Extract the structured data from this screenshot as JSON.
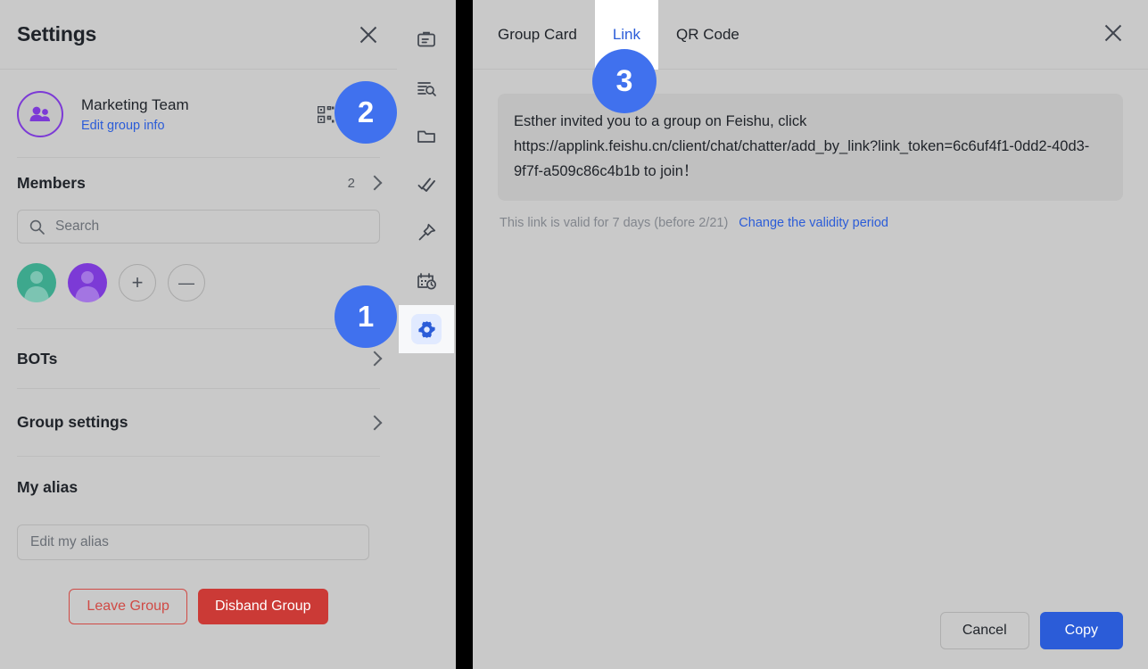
{
  "settings_panel": {
    "title": "Settings",
    "close_icon": "close-icon",
    "group": {
      "name": "Marketing Team",
      "edit_link": "Edit group info",
      "qr_icon": "qr-code-icon",
      "share_icon": "share-icon",
      "avatar_icon": "group-avatar-icon"
    },
    "members": {
      "title": "Members",
      "count": "2",
      "search_placeholder": "Search",
      "search_icon": "search-icon",
      "chevron_icon": "chevron-right-icon",
      "avatars": [
        {
          "name": "member-avatar-teal",
          "color": "#3da88d"
        },
        {
          "name": "member-avatar-purple",
          "color": "#7c3ad6"
        }
      ],
      "add_label": "+",
      "remove_label": "—"
    },
    "bots": {
      "title": "BOTs",
      "chevron_icon": "chevron-right-icon"
    },
    "group_settings": {
      "title": "Group settings",
      "chevron_icon": "chevron-right-icon"
    },
    "my_alias": {
      "title": "My alias",
      "placeholder": "Edit my alias"
    },
    "actions": {
      "leave_label": "Leave Group",
      "disband_label": "Disband Group",
      "leave_color": "#d04a45",
      "disband_color": "#cb3a36"
    }
  },
  "icon_rail": {
    "items": [
      {
        "name": "clipboard-icon",
        "active": false
      },
      {
        "name": "search-list-icon",
        "active": false
      },
      {
        "name": "folder-icon",
        "active": false
      },
      {
        "name": "tasks-check-icon",
        "active": false
      },
      {
        "name": "pin-icon",
        "active": false
      },
      {
        "name": "calendar-clock-icon",
        "active": false
      },
      {
        "name": "gear-icon",
        "active": true
      }
    ],
    "active_color": "#2b5cd8"
  },
  "dialog": {
    "tabs": [
      {
        "label": "Group Card",
        "active": false
      },
      {
        "label": "Link",
        "active": true
      },
      {
        "label": "QR Code",
        "active": false
      }
    ],
    "close_icon": "close-icon",
    "message": "Esther invited you to a group on Feishu, click https://applink.feishu.cn/client/chat/chatter/add_by_link?link_token=6c6uf4f1-0dd2-40d3-9f7f-a509c86c4b1b to join！",
    "validity_text": "This link is valid for 7 days (before 2/21)",
    "validity_link": "Change the validity period",
    "cancel_label": "Cancel",
    "copy_label": "Copy",
    "accent_color": "#2b5cd8"
  },
  "badges": [
    {
      "label": "1",
      "color": "#4071ee"
    },
    {
      "label": "2",
      "color": "#4071ee"
    },
    {
      "label": "3",
      "color": "#4071ee"
    }
  ]
}
